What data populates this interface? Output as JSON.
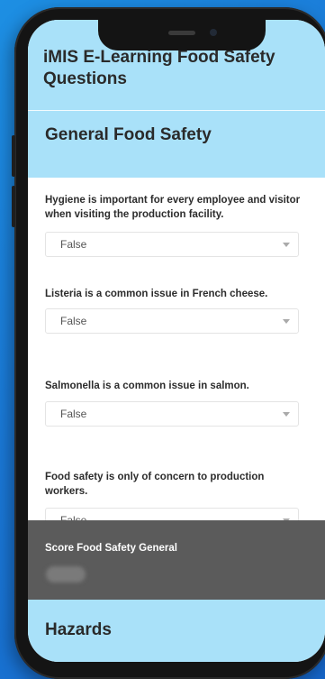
{
  "header": {
    "title": "iMIS E-Learning Food Safety Questions"
  },
  "section": {
    "title": "General Food Safety"
  },
  "questions": [
    {
      "text": "Hygiene is important for every employee and visitor when visiting the production facility.",
      "value": "False"
    },
    {
      "text": "Listeria is a common issue in French cheese.",
      "value": "False"
    },
    {
      "text": "Salmonella is a common issue in salmon.",
      "value": "False"
    },
    {
      "text": "Food safety is only of concern to production workers.",
      "value": "False"
    }
  ],
  "score": {
    "label": "Score Food Safety General"
  },
  "next_section": {
    "title": "Hazards"
  },
  "colors": {
    "header_bg": "#a9e1f9",
    "score_bg": "#5b5b5b",
    "background": "#1a78d6"
  }
}
